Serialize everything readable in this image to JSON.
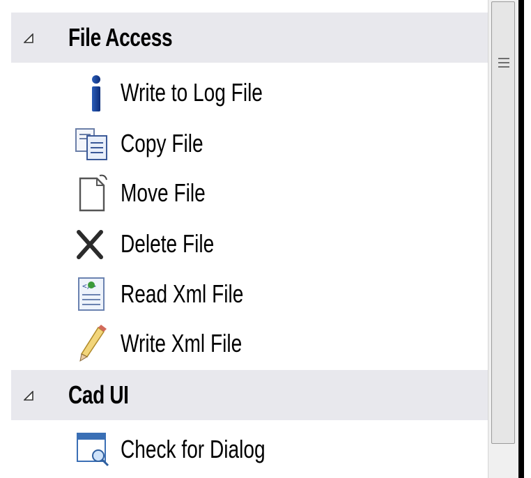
{
  "groups": [
    {
      "title": "File Access",
      "items": [
        {
          "label": "Write to Log File",
          "icon": "info-icon"
        },
        {
          "label": "Copy File",
          "icon": "copy-file-icon"
        },
        {
          "label": "Move File",
          "icon": "move-file-icon"
        },
        {
          "label": "Delete File",
          "icon": "delete-icon"
        },
        {
          "label": "Read Xml File",
          "icon": "xml-file-icon"
        },
        {
          "label": "Write Xml File",
          "icon": "pencil-icon"
        }
      ]
    },
    {
      "title": "Cad UI",
      "items": [
        {
          "label": "Check for Dialog",
          "icon": "dialog-search-icon"
        }
      ]
    }
  ],
  "colors": {
    "group_header_bg": "#e8e8ed",
    "scrollbar_bg": "#f0f0f0"
  }
}
